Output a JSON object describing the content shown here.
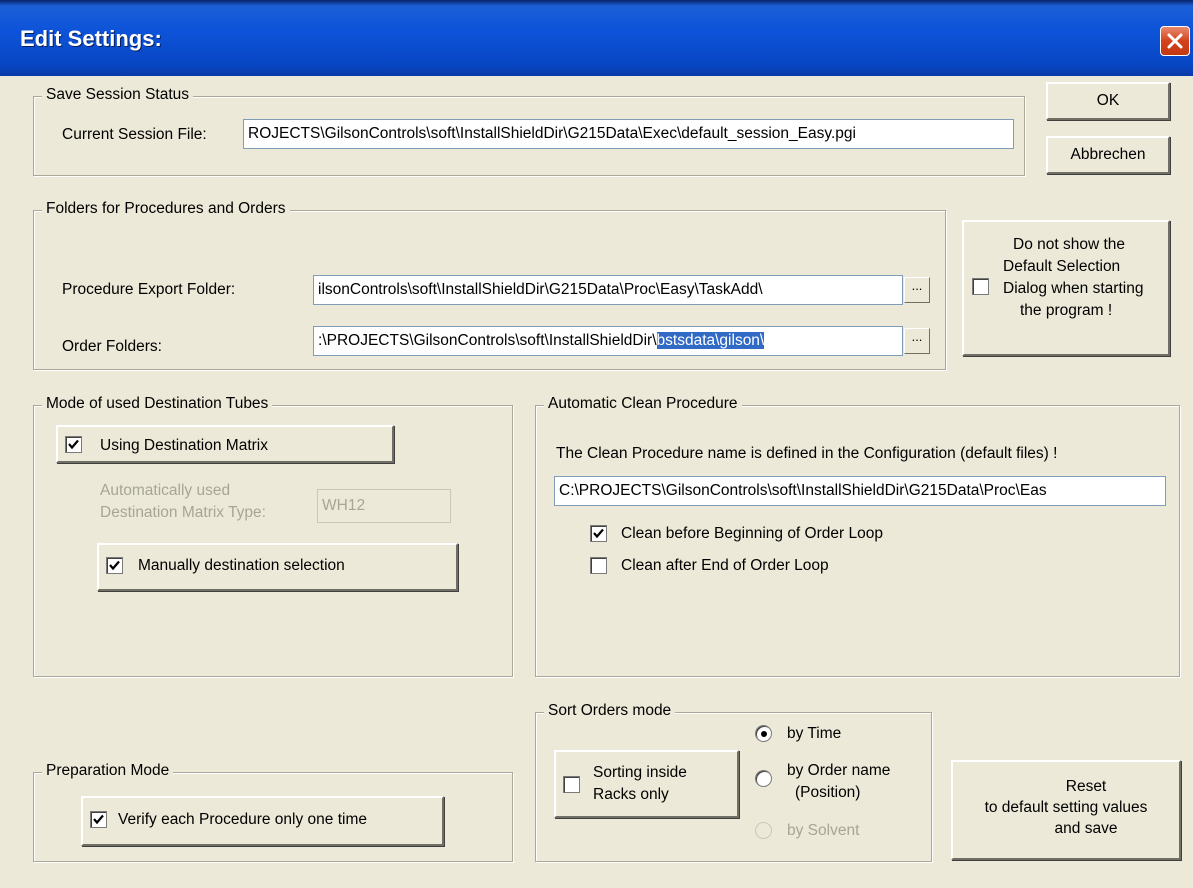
{
  "window": {
    "title": "Edit Settings:"
  },
  "buttons": {
    "ok": "OK",
    "cancel": "Abbrechen",
    "browse": "...",
    "reset_line1": "Reset",
    "reset_line2": "to default setting values",
    "reset_line3": "and save"
  },
  "save_session": {
    "group_title": "Save Session Status",
    "file_label": "Current Session File:",
    "file_value": "ROJECTS\\GilsonControls\\soft\\InstallShieldDir\\G215Data\\Exec\\default_session_Easy.pgi"
  },
  "folders": {
    "group_title": "Folders for Procedures and Orders",
    "procedure_label": "Procedure Export Folder:",
    "procedure_value": "ilsonControls\\soft\\InstallShieldDir\\G215Data\\Proc\\Easy\\TaskAdd\\",
    "order_label": "Order Folders:",
    "order_value_plain": ":\\PROJECTS\\GilsonControls\\soft\\InstallShieldDir\\",
    "order_value_selected": "bstsdata\\gilson\\"
  },
  "default_selection": {
    "checked": false,
    "line1": "Do not show the",
    "line2": "Default Selection",
    "line3": "Dialog when starting",
    "line4": "the program !"
  },
  "destination": {
    "group_title": "Mode of used Destination Tubes",
    "matrix_label": "Using Destination Matrix",
    "matrix_checked": true,
    "auto_label_line1": "Automatically used",
    "auto_label_line2": "Destination Matrix Type:",
    "matrix_type_value": "WH12",
    "manual_label": "Manually destination selection",
    "manual_checked": true
  },
  "clean": {
    "group_title": "Automatic Clean Procedure",
    "info_text": "The Clean Procedure name  is defined in the Configuration (default files) !",
    "path_value": "C:\\PROJECTS\\GilsonControls\\soft\\InstallShieldDir\\G215Data\\Proc\\Eas",
    "before_label": "Clean before Beginning of Order Loop",
    "before_checked": true,
    "after_label": "Clean after End of Order Loop",
    "after_checked": false
  },
  "sort": {
    "group_title": "Sort Orders mode",
    "racks_line1": "Sorting inside",
    "racks_line2": "Racks only",
    "racks_checked": false,
    "by_time": "by Time",
    "by_order_line1": "by Order name",
    "by_order_line2": "(Position)",
    "by_solvent": "by Solvent",
    "selected": "by Time"
  },
  "preparation": {
    "group_title": "Preparation Mode",
    "verify_label": "Verify each Procedure only one time",
    "verify_checked": true
  }
}
